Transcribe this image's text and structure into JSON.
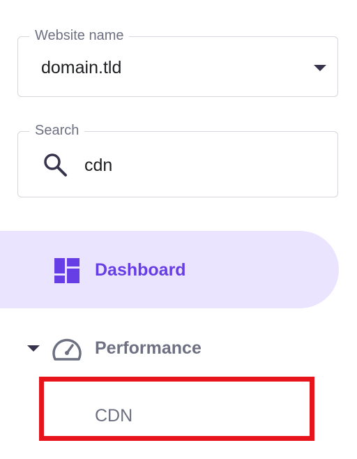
{
  "website_select": {
    "label": "Website name",
    "value": "domain.tld"
  },
  "search": {
    "label": "Search",
    "value": "cdn"
  },
  "nav": {
    "dashboard_label": "Dashboard",
    "performance_label": "Performance",
    "sub_items": [
      {
        "label": "CDN"
      }
    ]
  },
  "icons": {
    "dropdown": "chevron-down-icon",
    "search": "search-icon",
    "dashboard": "dashboard-icon",
    "expand": "caret-down-icon",
    "performance": "speedometer-icon"
  },
  "colors": {
    "accent": "#673de6",
    "active_bg": "#ebe4ff",
    "highlight_border": "#e8141c",
    "text_muted": "#6d7081"
  }
}
